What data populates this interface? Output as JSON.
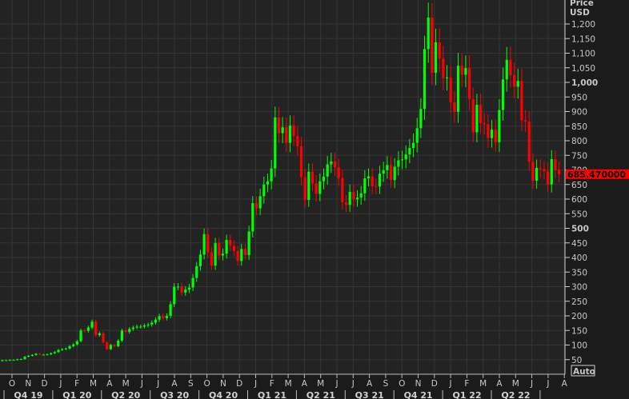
{
  "chart_data": {
    "type": "candlestick",
    "title": "",
    "ylabel": "Price USD",
    "ylabel_line1": "Price",
    "ylabel_line2": "USD",
    "currency": "USD",
    "ylim": [
      30,
      1250
    ],
    "y_ticks": [
      50,
      100,
      150,
      200,
      250,
      300,
      350,
      400,
      450,
      500,
      550,
      600,
      650,
      700,
      750,
      800,
      850,
      900,
      950,
      1000,
      1050,
      1100,
      1150,
      1200
    ],
    "y_tick_labels": [
      "50",
      "100",
      "150",
      "200",
      "250",
      "300",
      "350",
      "400",
      "450",
      "500",
      "550",
      "600",
      "650",
      "700",
      "750",
      "800",
      "850",
      "900",
      "950",
      "1,000",
      "1,050",
      "1,100",
      "1,150",
      "1,200"
    ],
    "y_bold_ticks": [
      "500",
      "1,000"
    ],
    "grid": true,
    "start_week": "2019-09-06",
    "interval": "week",
    "closes": [
      45,
      48,
      48,
      49,
      49,
      51,
      52,
      60,
      63,
      66,
      70,
      67,
      67,
      68,
      72,
      76,
      83,
      86,
      88,
      96,
      102,
      113,
      150,
      149,
      160,
      180,
      134,
      140,
      109,
      86,
      100,
      96,
      115,
      150,
      145,
      155,
      160,
      163,
      163,
      167,
      170,
      177,
      187,
      199,
      192,
      200,
      240,
      300,
      300,
      280,
      290,
      297,
      330,
      370,
      410,
      480,
      418,
      372,
      449,
      407,
      413,
      460,
      440,
      422,
      388,
      429,
      408,
      489,
      586,
      568,
      610,
      650,
      661,
      705,
      880,
      826,
      846,
      793,
      852,
      816,
      781,
      675,
      597,
      694,
      654,
      618,
      661,
      677,
      719,
      729,
      709,
      672,
      589,
      580,
      625,
      599,
      605,
      620,
      671,
      678,
      644,
      643,
      687,
      699,
      717,
      665,
      711,
      733,
      736,
      753,
      775,
      793,
      843,
      909,
      1114,
      1222,
      1033,
      1137,
      1081,
      1014,
      1017,
      932,
      899,
      1057,
      1026,
      1049,
      943,
      829,
      923,
      860,
      856,
      809,
      838,
      795,
      905,
      1010,
      1077,
      1025,
      985,
      1005,
      870,
      865,
      728,
      663,
      707,
      703,
      696,
      650,
      737,
      700,
      685
    ],
    "last_price": 685.47,
    "last_price_label": "685.470000",
    "x_month_labels": [
      "O",
      "N",
      "D",
      "J",
      "F",
      "M",
      "A",
      "M",
      "J",
      "J",
      "A",
      "S",
      "O",
      "N",
      "D",
      "J",
      "F",
      "M",
      "A",
      "M",
      "J",
      "J",
      "A",
      "S",
      "O",
      "N",
      "D",
      "J",
      "F",
      "M",
      "A",
      "M",
      "J",
      "J",
      "A"
    ],
    "x_quarter_labels": [
      "Q4 19",
      "Q1 20",
      "Q2 20",
      "Q3 20",
      "Q4 20",
      "Q1 21",
      "Q2 21",
      "Q3 21",
      "Q4 21",
      "Q1 22",
      "Q2 22"
    ],
    "auto_label": "Auto",
    "colors": {
      "up": "#00ff00",
      "down": "#ff0000",
      "background": "#232323",
      "grid": "#353535",
      "axis": "#c8c8c8",
      "last_price_bg": "#ff0000"
    }
  }
}
